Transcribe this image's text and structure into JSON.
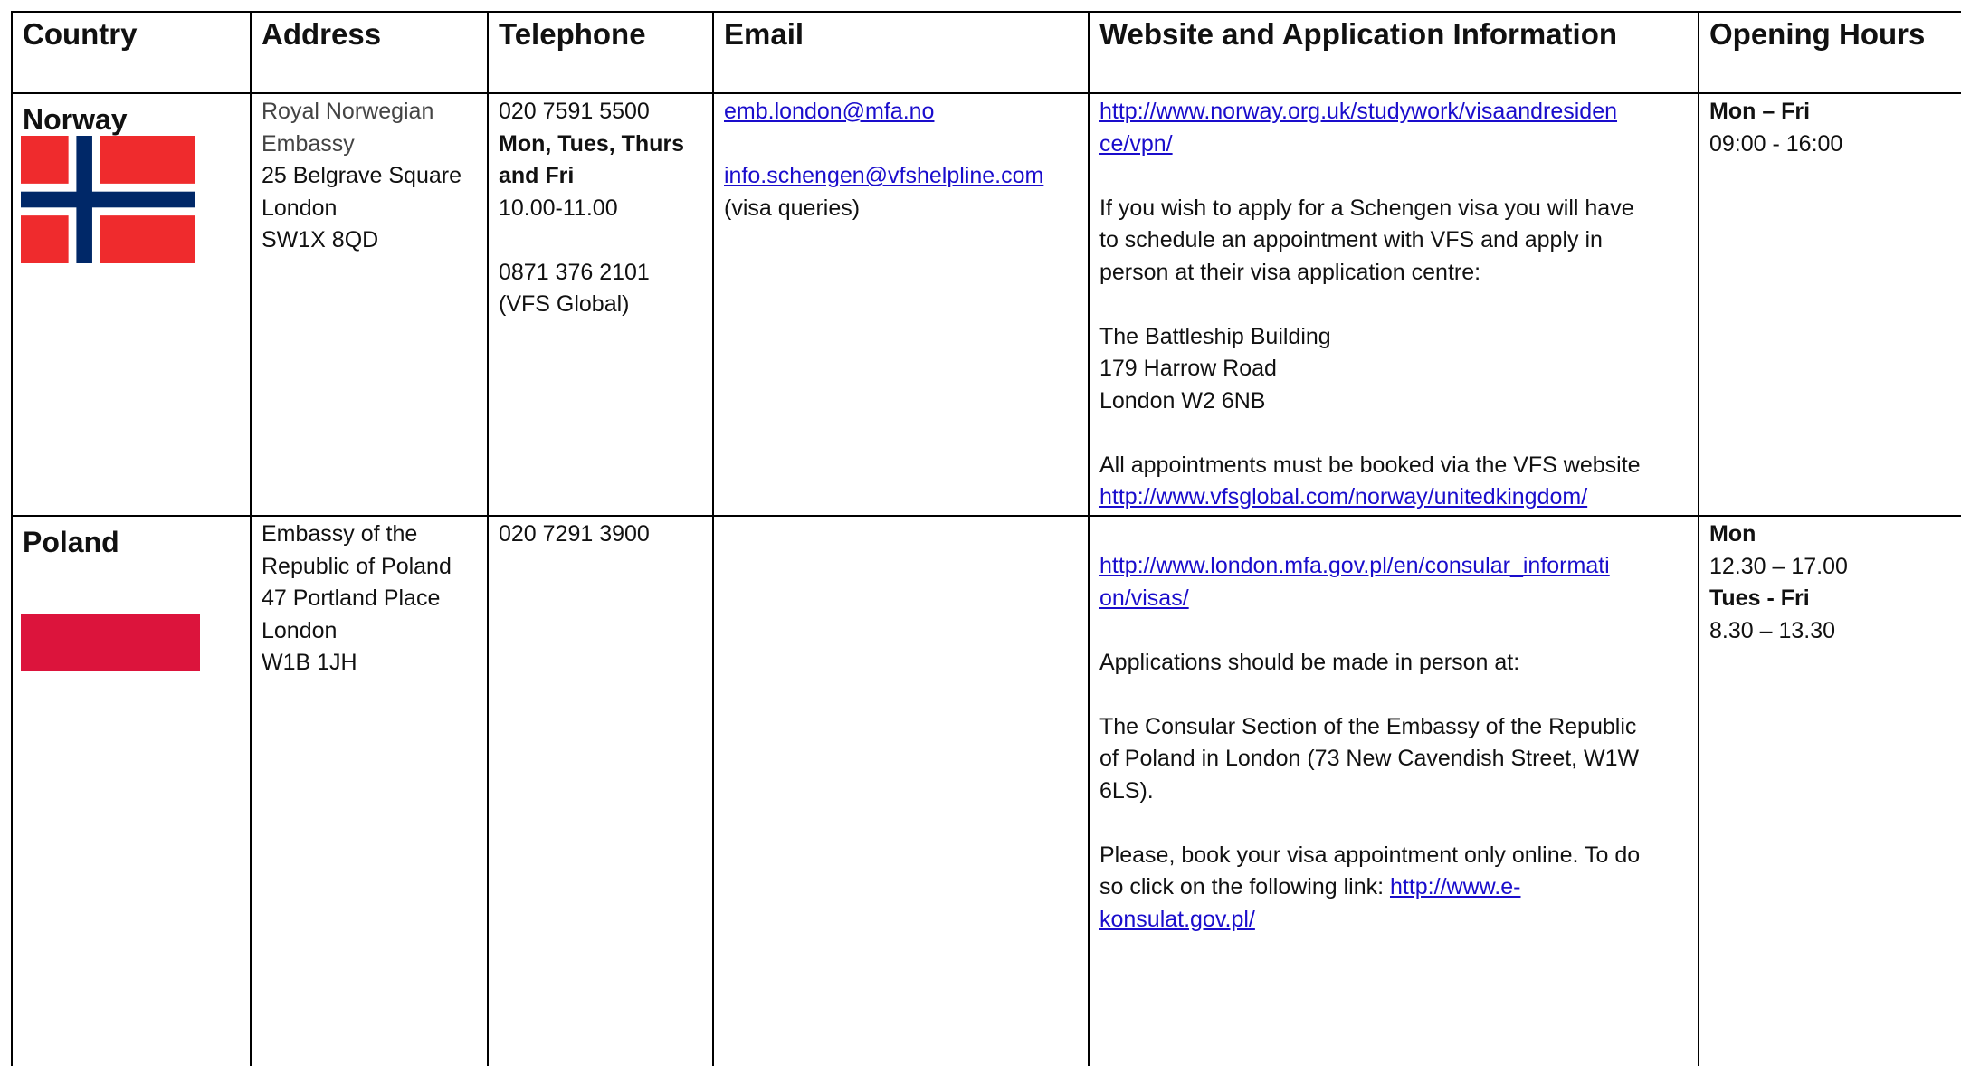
{
  "headers": {
    "country": "Country",
    "address": "Address",
    "telephone": "Telephone",
    "email": "Email",
    "website": "Website and Application Information",
    "hours": "Opening Hours"
  },
  "rows": [
    {
      "country": "Norway",
      "flag": "norway-flag",
      "address": [
        "Royal Norwegian",
        "Embassy",
        "25 Belgrave Square",
        "London",
        "SW1X 8QD"
      ],
      "telephone": {
        "main": "020 7591 5500",
        "days_1": "Mon, Tues, Thurs",
        "days_2": "and Fri",
        "hours": "10.00-11.00",
        "vfs": "0871 376 2101",
        "vfs_note": "(VFS Global)"
      },
      "email": {
        "primary": "emb.london@mfa.no",
        "visa": "info.schengen@vfshelpline.com",
        "visa_note": "(visa queries)"
      },
      "website": {
        "url_1": "http://www.norway.org.uk/studywork/visaandresiden",
        "url_2": "ce/vpn/",
        "para_1": [
          "If you wish to apply for a Schengen visa you will have",
          "to schedule an appointment with VFS and apply in",
          "person at their visa application centre:"
        ],
        "address": [
          "The Battleship Building",
          "179 Harrow Road",
          "London W2 6NB"
        ],
        "booking_text": "All appointments must be booked via the VFS website",
        "booking_url": "http://www.vfsglobal.com/norway/unitedkingdom/"
      },
      "hours": {
        "days": "Mon – Fri",
        "time": "09:00 - 16:00"
      }
    },
    {
      "country": "Poland",
      "flag": "poland-flag",
      "address": [
        "Embassy of the",
        "Republic of Poland",
        "47 Portland Place",
        "London",
        "W1B 1JH"
      ],
      "telephone": {
        "main": "020 7291 3900"
      },
      "website": {
        "url_1": "http://www.london.mfa.gov.pl/en/consular_informati",
        "url_2": "on/visas/",
        "para_1": "Applications should be made in person at:",
        "para_2": [
          "The Consular Section of the Embassy of the Republic",
          "of Poland in London (73 New Cavendish Street, W1W",
          "6LS)."
        ],
        "para_3_line1": "Please, book your visa appointment only online. To do",
        "para_3_line2_text": "so click on the following link: ",
        "para_3_link_1": "http://www.e-",
        "para_3_link_2": "konsulat.gov.pl/"
      },
      "hours": {
        "days_1": "Mon",
        "time_1": "12.30 – 17.00",
        "days_2": "Tues - Fri",
        "time_2": "8.30 – 13.30"
      }
    }
  ]
}
